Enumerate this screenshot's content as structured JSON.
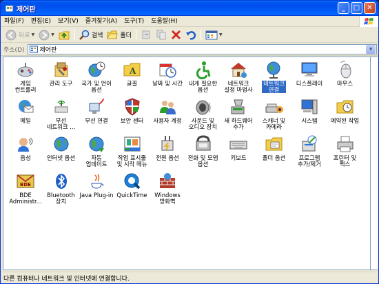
{
  "window": {
    "title": "제어판",
    "buttons": {
      "minimize": "_",
      "maximize": "□",
      "close": "✕"
    }
  },
  "menu": [
    "파일(F)",
    "편집(E)",
    "보기(V)",
    "즐겨찾기(A)",
    "도구(T)",
    "도움말(H)"
  ],
  "toolbar": {
    "back": "뒤로",
    "search": "검색",
    "folders": "폴더"
  },
  "address": {
    "label": "주소(D)",
    "value": "제어판"
  },
  "items": [
    {
      "label": "게임\n컨트롤러",
      "icon": "gamepad-icon"
    },
    {
      "label": "관리 도구",
      "icon": "admin-tools-icon"
    },
    {
      "label": "국가 및 언어\n옵션",
      "icon": "globe-clock-icon"
    },
    {
      "label": "글꼴",
      "icon": "fonts-folder-icon"
    },
    {
      "label": "날짜 및 시간",
      "icon": "calendar-clock-icon"
    },
    {
      "label": "내게 필요한\n옵션",
      "icon": "accessibility-icon"
    },
    {
      "label": "네트워크\n설정 마법사",
      "icon": "network-house-icon"
    },
    {
      "label": "네트워크\n연결",
      "icon": "network-globe-icon"
    },
    {
      "label": "디스플레이",
      "icon": "monitor-icon"
    },
    {
      "label": "마우스",
      "icon": "mouse-icon"
    },
    {
      "label": "메일",
      "icon": "mail-icon"
    },
    {
      "label": "무선\n네트워크 ...",
      "icon": "wireless-network-icon"
    },
    {
      "label": "무선 연결",
      "icon": "wireless-link-icon"
    },
    {
      "label": "보안 센터",
      "icon": "shield-icon"
    },
    {
      "label": "사용자 계정",
      "icon": "users-icon"
    },
    {
      "label": "사운드 및\n오디오 장치",
      "icon": "speaker-icon"
    },
    {
      "label": "새 하드웨어\n추가",
      "icon": "hardware-icon"
    },
    {
      "label": "스캐너 및\n카메라",
      "icon": "scanner-icon"
    },
    {
      "label": "시스템",
      "icon": "system-icon"
    },
    {
      "label": "예약된 작업",
      "icon": "scheduled-tasks-icon"
    },
    {
      "label": "음성",
      "icon": "speech-icon"
    },
    {
      "label": "인터넷 옵션",
      "icon": "internet-globe-icon"
    },
    {
      "label": "자동\n업데이트",
      "icon": "update-globe-icon"
    },
    {
      "label": "작업 표시줄\n및 시작 메뉴",
      "icon": "taskbar-icon"
    },
    {
      "label": "전원 옵션",
      "icon": "power-icon"
    },
    {
      "label": "전화 및 모뎀\n옵션",
      "icon": "phone-icon"
    },
    {
      "label": "키보드",
      "icon": "keyboard-icon"
    },
    {
      "label": "폴더 옵션",
      "icon": "folder-options-icon"
    },
    {
      "label": "프로그램\n추가/제거",
      "icon": "add-remove-icon"
    },
    {
      "label": "프린터 및\n팩스",
      "icon": "printer-icon"
    },
    {
      "label": "BDE\nAdministr...",
      "icon": "bde-icon"
    },
    {
      "label": "Bluetooth\n장치",
      "icon": "bluetooth-icon"
    },
    {
      "label": "Java Plug-in",
      "icon": "java-icon"
    },
    {
      "label": "QuickTime",
      "icon": "quicktime-icon"
    },
    {
      "label": "Windows\n방화벽",
      "icon": "firewall-icon"
    }
  ],
  "status": "다른 컴퓨터나 네트워크 및 인터넷에 연결합니다.",
  "colors": {
    "titlebar": "#0053ee",
    "selection": "#316ac5",
    "chrome": "#ece9d8"
  }
}
